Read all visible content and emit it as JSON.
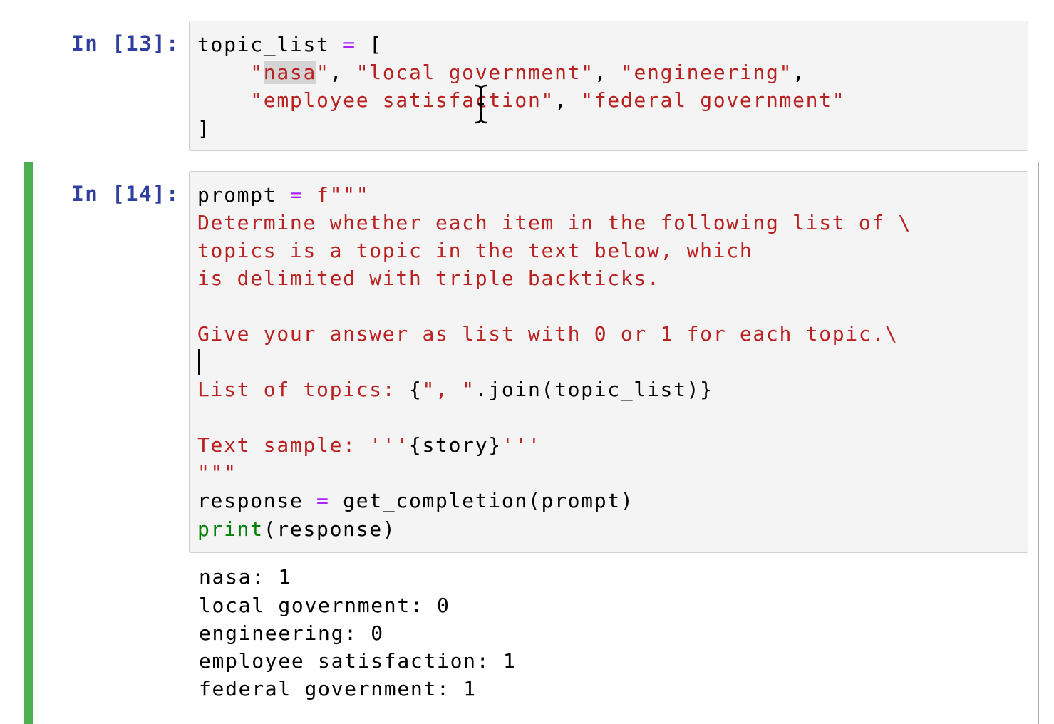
{
  "cell1": {
    "prompt": "In [13]:",
    "lines": {
      "l1_a": "topic_list ",
      "l1_op": "=",
      "l1_b": " [",
      "l2_indent": "    ",
      "l2_q1": "\"",
      "l2_nasa": "nasa",
      "l2_rest_q": "\"",
      "l2_comma1": ", ",
      "l2_local": "\"local government\"",
      "l2_comma2": ", ",
      "l2_eng": "\"engineering\"",
      "l2_comma3": ",",
      "l3_indent": "    ",
      "l3_emp": "\"employee satisfaction\"",
      "l3_comma": ", ",
      "l3_fed": "\"federal government\"",
      "l4": "]"
    }
  },
  "cell2": {
    "prompt": "In [14]:",
    "lines": {
      "l1_a": "prompt ",
      "l1_op": "=",
      "l1_b": " ",
      "l1_str": "f\"\"\"",
      "l2": "Determine whether each item in the following list of \\",
      "l3": "topics is a topic in the text below, which",
      "l4": "is delimited with triple backticks.",
      "l6": "Give your answer as list with 0 or 1 for each topic.\\",
      "l8_str": "List of topics: ",
      "l8_code1": "{",
      "l8_str2": "\", \"",
      "l8_code2": ".join(topic_list)}",
      "l10_str": "Text sample: '''",
      "l10_code": "{story}",
      "l10_str2": "'''",
      "l11": "\"\"\"",
      "l12_a": "response ",
      "l12_op": "=",
      "l12_b": " get_completion(prompt)",
      "l13_kw": "print",
      "l13_b": "(response)"
    },
    "output": [
      "nasa: 1",
      "local government: 0",
      "engineering: 0",
      "employee satisfaction: 1",
      "federal government: 1"
    ]
  },
  "colors": {
    "prompt_in": "#303f9f",
    "string": "#ba2121",
    "operator": "#aa22ff",
    "builtin": "#008000",
    "selected_cell_bar": "#4caf50",
    "input_background": "#f4f4f4"
  },
  "icons": {
    "mouse_cursor": "ibeam-cursor-icon"
  }
}
